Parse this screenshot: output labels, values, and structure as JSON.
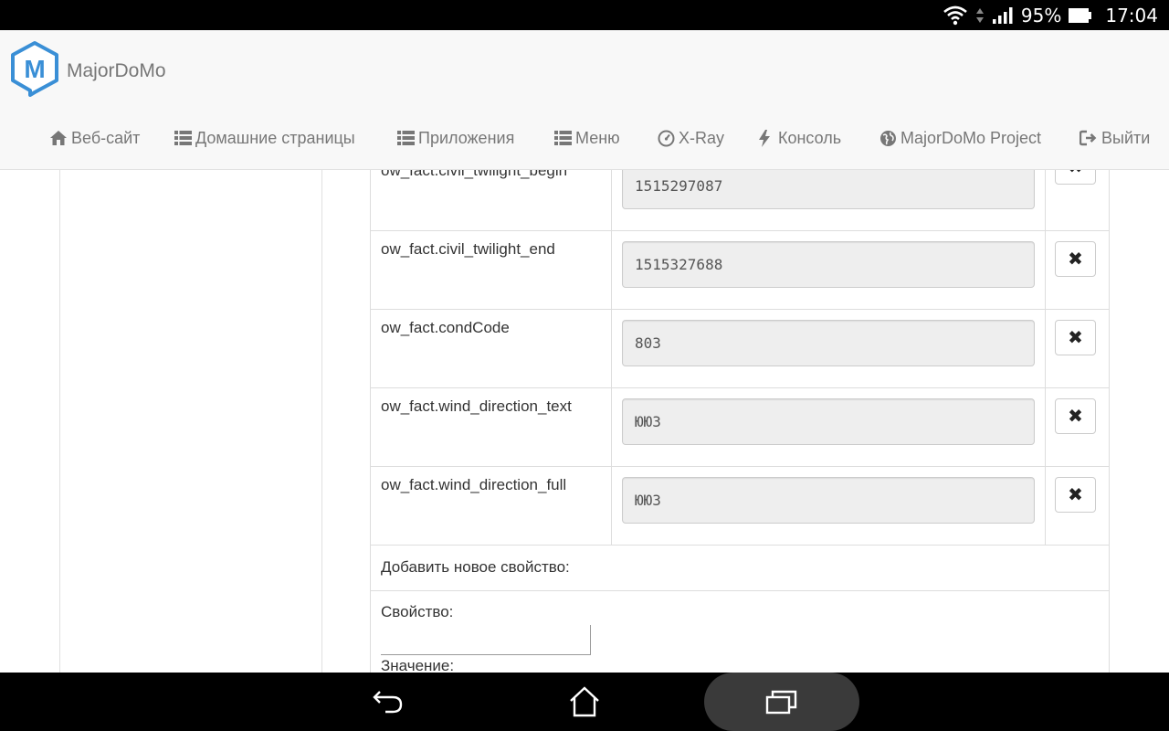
{
  "status_bar": {
    "battery": "95%",
    "time": "17:04"
  },
  "brand": {
    "title": "MajorDoMo",
    "logo_letter": "M",
    "accent": "#3a8fd6"
  },
  "nav": {
    "items": [
      {
        "label": "Веб-сайт",
        "icon": "home-icon"
      },
      {
        "label": "Домашние страницы",
        "icon": "list-icon"
      },
      {
        "label": "Приложения",
        "icon": "list-icon"
      },
      {
        "label": "Меню",
        "icon": "list-icon"
      },
      {
        "label": "X-Ray",
        "icon": "dashboard-icon"
      },
      {
        "label": "Консоль",
        "icon": "flash-icon"
      },
      {
        "label": "MajorDoMo Project",
        "icon": "globe-icon"
      },
      {
        "label": "Выйти",
        "icon": "logout-icon"
      }
    ]
  },
  "properties": [
    {
      "name": "ow_fact.civil_twilight_begin",
      "value": "1515297087",
      "delete_label": "✖"
    },
    {
      "name": "ow_fact.civil_twilight_end",
      "value": "1515327688",
      "delete_label": "✖"
    },
    {
      "name": "ow_fact.condCode",
      "value": "803",
      "delete_label": "✖"
    },
    {
      "name": "ow_fact.wind_direction_text",
      "value": "ЮЮЗ",
      "delete_label": "✖"
    },
    {
      "name": "ow_fact.wind_direction_full",
      "value": "ЮЮЗ",
      "delete_label": "✖"
    }
  ],
  "add_form": {
    "heading": "Добавить новое свойство:",
    "property_label": "Свойство:",
    "property_value": "",
    "value_label": "Значение:"
  }
}
